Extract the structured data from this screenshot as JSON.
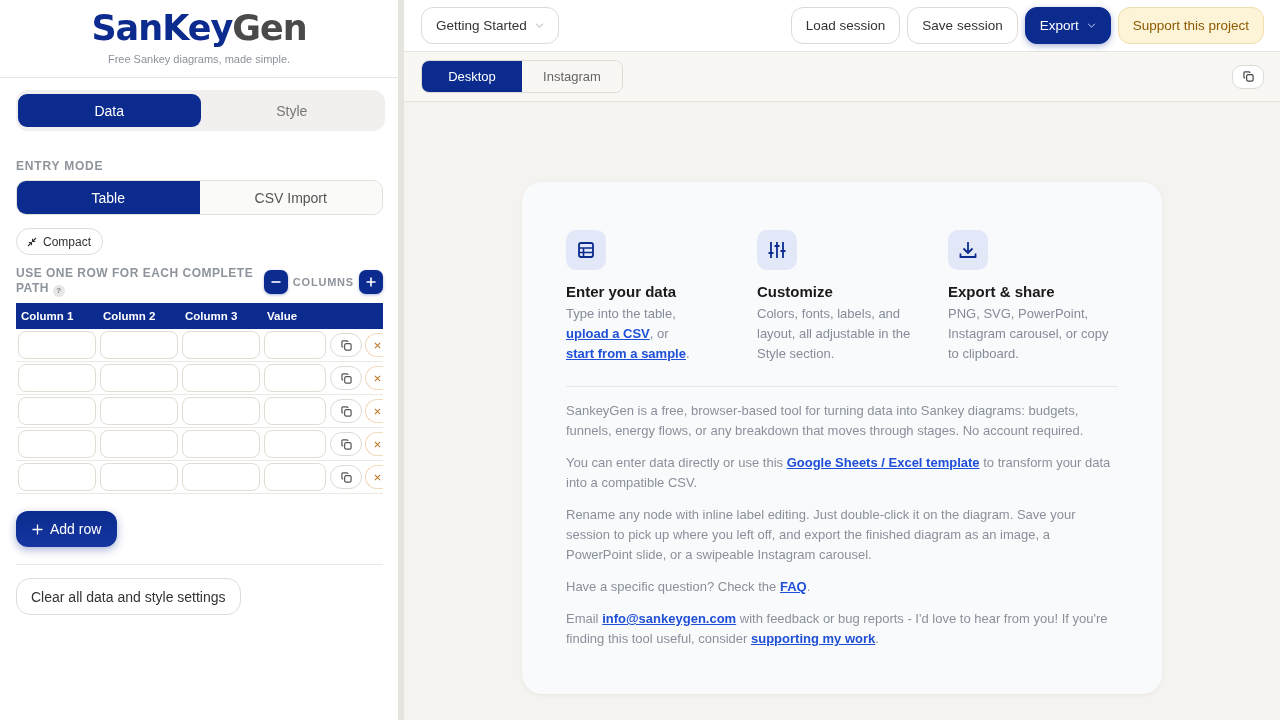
{
  "sidebar": {
    "logo": {
      "primary": "SanKey",
      "secondary": "Gen"
    },
    "tagline": "Free Sankey diagrams, made simple.",
    "tabs": [
      {
        "label": "Data",
        "selected": true
      },
      {
        "label": "Style",
        "selected": false
      }
    ],
    "entry_mode": {
      "label": "ENTRY MODE",
      "options": [
        {
          "label": "Table",
          "selected": true
        },
        {
          "label": "CSV Import",
          "selected": false
        }
      ]
    },
    "compact_button": "Compact",
    "path_hint": {
      "text": "USE ONE ROW FOR EACH COMPLETE PATH",
      "help_mark": "?"
    },
    "columns_label": "COLUMNS",
    "table": {
      "columns": [
        "Column 1",
        "Column 2",
        "Column 3",
        "Value"
      ],
      "rows": [
        {},
        {},
        {},
        {},
        {}
      ]
    },
    "add_row_button": "Add row",
    "clear_button": "Clear all data and style settings"
  },
  "toolbar": {
    "guide_menu": "Getting Started",
    "buttons": [
      {
        "label": "Load session",
        "kind": "outline"
      },
      {
        "label": "Save session",
        "kind": "outline"
      },
      {
        "label": "Export",
        "kind": "dropdown"
      },
      {
        "label": "Support this project",
        "kind": "support"
      }
    ]
  },
  "view_tabs": [
    {
      "label": "Desktop",
      "selected": true
    },
    {
      "label": "Instagram",
      "selected": false
    }
  ],
  "welcome_card": {
    "features": [
      {
        "title": "Enter your data",
        "text": [
          {
            "kind": "text",
            "text": "Type into the table, "
          },
          {
            "kind": "link",
            "text": "upload a CSV"
          },
          {
            "kind": "text",
            "text": ", or "
          },
          {
            "kind": "link",
            "text": "start from a sample"
          },
          {
            "kind": "text",
            "text": "."
          }
        ]
      },
      {
        "title": "Customize",
        "text": [
          {
            "kind": "text",
            "text": "Colors, fonts, labels, and layout, all adjustable in the Style section."
          }
        ]
      },
      {
        "title": "Export & share",
        "text": [
          {
            "kind": "text",
            "text": "PNG, SVG, PowerPoint, Instagram carousel, or copy to clipboard."
          }
        ]
      }
    ],
    "paragraphs": [
      [
        {
          "kind": "text",
          "text": "SankeyGen is a free, browser-based tool for turning data into Sankey diagrams: budgets, funnels, energy flows, or any breakdown that moves through stages. No account required."
        }
      ],
      [
        {
          "kind": "text",
          "text": "You can enter data directly or use this "
        },
        {
          "kind": "link",
          "text": "Google Sheets / Excel template"
        },
        {
          "kind": "text",
          "text": " to transform your data into a compatible CSV."
        }
      ],
      [
        {
          "kind": "text",
          "text": "Rename any node with inline label editing. Just double-click it on the diagram. Save your session to pick up where you left off, and export the finished diagram as an image, a PowerPoint slide, or a swipeable Instagram carousel."
        }
      ],
      [
        {
          "kind": "text",
          "text": "Have a specific question? Check the "
        },
        {
          "kind": "link",
          "text": "FAQ"
        },
        {
          "kind": "text",
          "text": "."
        }
      ],
      [
        {
          "kind": "text",
          "text": "Email "
        },
        {
          "kind": "link",
          "text": "info@sankeygen.com"
        },
        {
          "kind": "text",
          "text": " with feedback or bug reports - I'd love to hear from you! If you're finding this tool useful, consider "
        },
        {
          "kind": "link",
          "text": "supporting my work"
        },
        {
          "kind": "text",
          "text": "."
        }
      ]
    ]
  }
}
